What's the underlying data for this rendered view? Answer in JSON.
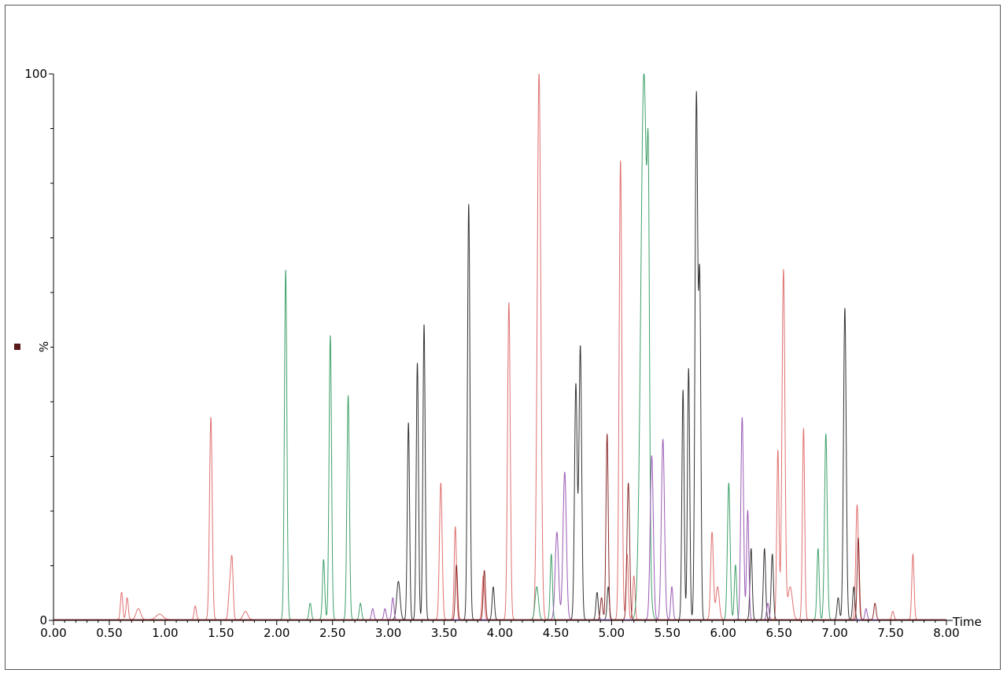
{
  "chart_data": {
    "type": "line",
    "title": "",
    "xlabel": "Time",
    "ylabel": "%",
    "xlim": [
      0,
      8
    ],
    "ylim": [
      0,
      100
    ],
    "grid": false,
    "x_ticks": [
      0,
      0.5,
      1,
      1.5,
      2,
      2.5,
      3,
      3.5,
      4,
      4.5,
      5,
      5.5,
      6,
      6.5,
      7,
      7.5,
      8
    ],
    "x_tick_labels": [
      "0.00",
      "0.50",
      "1.00",
      "1.50",
      "2.00",
      "2.50",
      "3.00",
      "3.50",
      "4.00",
      "4.50",
      "5.00",
      "5.50",
      "6.00",
      "6.50",
      "7.00",
      "7.50",
      "8.00"
    ],
    "y_tick_labels": [
      "100",
      "0"
    ],
    "legend_marker_color": "#5a1a1a",
    "series": [
      {
        "color": "#e07070",
        "peaks": [
          {
            "t": 0.61,
            "h": 5,
            "w": 0.01
          },
          {
            "t": 0.66,
            "h": 4,
            "w": 0.01
          },
          {
            "t": 0.76,
            "h": 2,
            "w": 0.02
          },
          {
            "t": 0.95,
            "h": 1,
            "w": 0.03
          },
          {
            "t": 1.27,
            "h": 2.5,
            "w": 0.01
          },
          {
            "t": 1.41,
            "h": 37,
            "w": 0.012
          },
          {
            "t": 1.58,
            "h": 6,
            "w": 0.012
          },
          {
            "t": 1.6,
            "h": 10,
            "w": 0.01
          },
          {
            "t": 1.72,
            "h": 1.5,
            "w": 0.02
          },
          {
            "t": 3.47,
            "h": 25,
            "w": 0.012
          },
          {
            "t": 3.6,
            "h": 17,
            "w": 0.01
          },
          {
            "t": 3.85,
            "h": 8,
            "w": 0.01
          },
          {
            "t": 4.08,
            "h": 58,
            "w": 0.012
          },
          {
            "t": 4.35,
            "h": 100,
            "w": 0.016
          },
          {
            "t": 5.08,
            "h": 84,
            "w": 0.012
          },
          {
            "t": 5.14,
            "h": 12,
            "w": 0.01
          },
          {
            "t": 5.2,
            "h": 8,
            "w": 0.01
          },
          {
            "t": 5.9,
            "h": 16,
            "w": 0.012
          },
          {
            "t": 5.95,
            "h": 6,
            "w": 0.015
          },
          {
            "t": 6.49,
            "h": 31,
            "w": 0.01
          },
          {
            "t": 6.54,
            "h": 64,
            "w": 0.013
          },
          {
            "t": 6.6,
            "h": 6,
            "w": 0.02
          },
          {
            "t": 6.72,
            "h": 35,
            "w": 0.01
          },
          {
            "t": 7.2,
            "h": 21,
            "w": 0.012
          },
          {
            "t": 7.52,
            "h": 1.5,
            "w": 0.01
          },
          {
            "t": 7.7,
            "h": 12,
            "w": 0.01
          }
        ]
      },
      {
        "color": "#3fa06a",
        "peaks": [
          {
            "t": 2.08,
            "h": 64,
            "w": 0.011
          },
          {
            "t": 2.3,
            "h": 3,
            "w": 0.01
          },
          {
            "t": 2.42,
            "h": 11,
            "w": 0.01
          },
          {
            "t": 2.48,
            "h": 52,
            "w": 0.011
          },
          {
            "t": 2.64,
            "h": 41,
            "w": 0.011
          },
          {
            "t": 2.75,
            "h": 3,
            "w": 0.01
          },
          {
            "t": 4.33,
            "h": 6,
            "w": 0.015
          },
          {
            "t": 4.46,
            "h": 12,
            "w": 0.01
          },
          {
            "t": 5.29,
            "h": 100,
            "w": 0.028
          },
          {
            "t": 5.33,
            "h": 50,
            "w": 0.01
          },
          {
            "t": 6.05,
            "h": 25,
            "w": 0.012
          },
          {
            "t": 6.11,
            "h": 10,
            "w": 0.01
          },
          {
            "t": 6.85,
            "h": 13,
            "w": 0.01
          },
          {
            "t": 6.92,
            "h": 34,
            "w": 0.012
          }
        ]
      },
      {
        "color": "#333333",
        "peaks": [
          {
            "t": 3.09,
            "h": 7,
            "w": 0.015
          },
          {
            "t": 3.18,
            "h": 36,
            "w": 0.01
          },
          {
            "t": 3.26,
            "h": 47,
            "w": 0.01
          },
          {
            "t": 3.32,
            "h": 54,
            "w": 0.01
          },
          {
            "t": 3.72,
            "h": 76,
            "w": 0.011
          },
          {
            "t": 3.94,
            "h": 6,
            "w": 0.01
          },
          {
            "t": 4.68,
            "h": 43,
            "w": 0.012
          },
          {
            "t": 4.72,
            "h": 50,
            "w": 0.012
          },
          {
            "t": 4.87,
            "h": 5,
            "w": 0.01
          },
          {
            "t": 4.97,
            "h": 6,
            "w": 0.01
          },
          {
            "t": 5.64,
            "h": 42,
            "w": 0.01
          },
          {
            "t": 5.69,
            "h": 46,
            "w": 0.01
          },
          {
            "t": 5.76,
            "h": 96,
            "w": 0.012
          },
          {
            "t": 5.79,
            "h": 60,
            "w": 0.01
          },
          {
            "t": 6.25,
            "h": 13,
            "w": 0.01
          },
          {
            "t": 6.37,
            "h": 13,
            "w": 0.01
          },
          {
            "t": 6.44,
            "h": 12,
            "w": 0.01
          },
          {
            "t": 7.03,
            "h": 4,
            "w": 0.01
          },
          {
            "t": 7.09,
            "h": 57,
            "w": 0.012
          },
          {
            "t": 7.17,
            "h": 6,
            "w": 0.01
          }
        ]
      },
      {
        "color": "#9a5ab4",
        "peaks": [
          {
            "t": 2.86,
            "h": 2,
            "w": 0.01
          },
          {
            "t": 2.97,
            "h": 2,
            "w": 0.01
          },
          {
            "t": 3.04,
            "h": 4,
            "w": 0.01
          },
          {
            "t": 4.51,
            "h": 16,
            "w": 0.015
          },
          {
            "t": 4.58,
            "h": 27,
            "w": 0.015
          },
          {
            "t": 5.36,
            "h": 30,
            "w": 0.014
          },
          {
            "t": 5.46,
            "h": 33,
            "w": 0.014
          },
          {
            "t": 5.54,
            "h": 6,
            "w": 0.01
          },
          {
            "t": 6.17,
            "h": 37,
            "w": 0.012
          },
          {
            "t": 6.22,
            "h": 20,
            "w": 0.01
          },
          {
            "t": 6.4,
            "h": 3,
            "w": 0.01
          },
          {
            "t": 7.28,
            "h": 2,
            "w": 0.01
          }
        ]
      },
      {
        "color": "#8b2a2a",
        "peaks": [
          {
            "t": 3.61,
            "h": 10,
            "w": 0.01
          },
          {
            "t": 3.86,
            "h": 9,
            "w": 0.01
          },
          {
            "t": 4.96,
            "h": 34,
            "w": 0.01
          },
          {
            "t": 4.91,
            "h": 4,
            "w": 0.01
          },
          {
            "t": 5.15,
            "h": 25,
            "w": 0.012
          },
          {
            "t": 7.21,
            "h": 15,
            "w": 0.01
          },
          {
            "t": 7.36,
            "h": 3,
            "w": 0.01
          }
        ]
      }
    ]
  }
}
